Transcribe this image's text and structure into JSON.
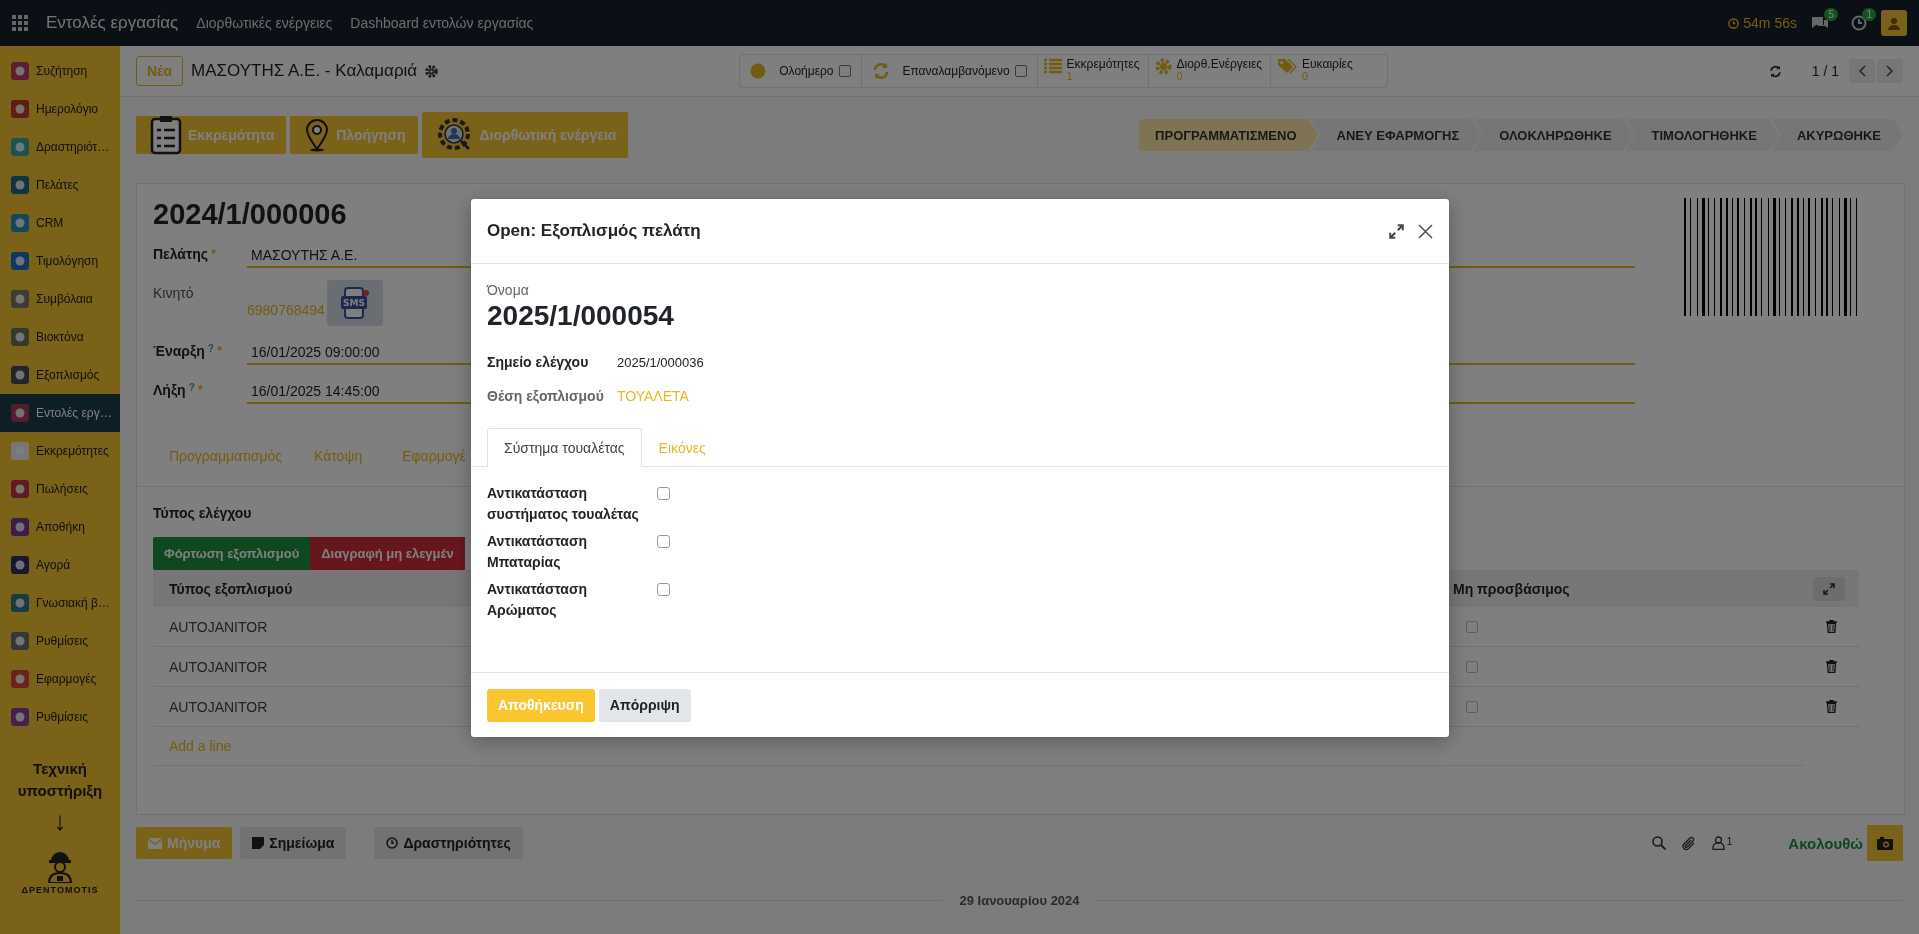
{
  "topbar": {
    "app_title": "Εντολές εργασίας",
    "links": [
      "Διορθωτικές ενέργειες",
      "Dashboard εντολών εργασίας"
    ],
    "timer": "54m 56s",
    "messages_count": "5",
    "activities_count": "1"
  },
  "sidebar": {
    "items": [
      {
        "label": "Συζήτηση",
        "selected": false
      },
      {
        "label": "Ημερολόγιο",
        "selected": false
      },
      {
        "label": "Δραστηριότ…",
        "selected": false
      },
      {
        "label": "Πελάτες",
        "selected": false
      },
      {
        "label": "CRM",
        "selected": false
      },
      {
        "label": "Τιμολόγηση",
        "selected": false
      },
      {
        "label": "Συμβόλαια",
        "selected": false
      },
      {
        "label": "Βιοκτόνα",
        "selected": false
      },
      {
        "label": "Εξοπλισμός",
        "selected": false
      },
      {
        "label": "Εντολές εργ…",
        "selected": true
      },
      {
        "label": "Εκκρεμότητες",
        "selected": false
      },
      {
        "label": "Πωλήσεις",
        "selected": false
      },
      {
        "label": "Αποθήκη",
        "selected": false
      },
      {
        "label": "Αγορά",
        "selected": false
      },
      {
        "label": "Γνωσιακή β…",
        "selected": false
      },
      {
        "label": "Ρυθμίσεις",
        "selected": false
      },
      {
        "label": "Εφαρμογές",
        "selected": false
      },
      {
        "label": "Ρυθμίσεις",
        "selected": false
      }
    ],
    "support_title": "Τεχνική υποστήριξη",
    "arrow": "↓",
    "logo_text": "ΔΡΕΝΤΟΜΟΤΙS"
  },
  "control_panel": {
    "new_button": "Νέα",
    "breadcrumb": "ΜΑΣΟΥΤΗΣ Α.Ε. - Καλαμαριά",
    "toggles": [
      {
        "label": "Ολοήμερο",
        "checked": false
      },
      {
        "label": "Επαναλαμβανόμενο",
        "checked": false
      }
    ],
    "stat_buttons": [
      {
        "label": "Εκκρεμότητες",
        "value": "1"
      },
      {
        "label": "Διορθ.Ενέργειες",
        "value": "0"
      },
      {
        "label": "Ευκαιρίες",
        "value": "0"
      }
    ],
    "pager": "1 / 1"
  },
  "action_buttons": [
    "Εκκρεμότητα",
    "Πλοήγηση",
    "Διορθωτική ενέργεια"
  ],
  "status_bar": [
    {
      "label": "ΠΡΟΓΡΑΜΜΑΤΙΣΜΕΝΟ",
      "selected": true
    },
    {
      "label": "ΑΝΕΥ ΕΦΑΡΜΟΓΗΣ",
      "selected": false
    },
    {
      "label": "ΟΛΟΚΛΗΡΩΘΗΚΕ",
      "selected": false
    },
    {
      "label": "ΤΙΜΟΛΟΓΗΘΗΚΕ",
      "selected": false
    },
    {
      "label": "ΑΚΥΡΩΘΗΚΕ",
      "selected": false
    }
  ],
  "form": {
    "title": "2024/1/000006",
    "fields": [
      {
        "label": "Πελάτης",
        "kind": "input",
        "value": "ΜΑΣΟΥΤΗΣ Α.Ε.",
        "required_mark": "*"
      },
      {
        "label": "Κινητό",
        "kind": "phone",
        "value": "6980768494",
        "sms_label": "SMS"
      },
      {
        "label": "Έναρξη",
        "kind": "input",
        "value": "16/01/2025 09:00:00",
        "help_mark": "?",
        "required_mark": "*"
      },
      {
        "label": "Λήξη",
        "kind": "input",
        "value": "16/01/2025 14:45:00",
        "help_mark": "?",
        "required_mark": "*"
      }
    ],
    "tabs": [
      "Προγραμματισμός",
      "Κάτοψη",
      "Εφαρμογέ"
    ],
    "section_label": "Τύπος ελέγχου",
    "buttons": [
      {
        "label": "Φόρτωση εξοπλισμού",
        "kind": "success"
      },
      {
        "label": "Διαγραφή μη ελεγμέν",
        "kind": "danger"
      }
    ],
    "columns": [
      "Τύπος εξοπλισμού",
      "Μη προσβάσιμος"
    ],
    "rows": [
      {
        "type": "AUTOJANITOR",
        "inaccessible": false
      },
      {
        "type": "AUTOJANITOR",
        "inaccessible": false
      },
      {
        "type": "AUTOJANITOR",
        "inaccessible": false
      }
    ],
    "add_line": "Add a line"
  },
  "chatter": {
    "buttons": [
      {
        "label": "Μήνυμα",
        "kind": "primary"
      },
      {
        "label": "Σημείωμα",
        "kind": "secondary"
      },
      {
        "label": "Δραστηριότητες",
        "kind": "secondary"
      }
    ],
    "followers_count": "1",
    "follow_label": "Ακολουθώ",
    "date": "29 Ιανουαρίου 2024"
  },
  "modal": {
    "title": "Open: Εξοπλισμός πελάτη",
    "name_label": "Όνομα",
    "name": "2025/1/000054",
    "fields": [
      {
        "label": "Σημείο ελέγχου",
        "value": "2025/1/000036",
        "kind": "text"
      },
      {
        "label": "Θέση εξοπλισμού",
        "value": "ΤΟΥΑΛΕΤΑ",
        "kind": "link"
      }
    ],
    "tabs": [
      {
        "label": "Σύστημα τουαλέτας",
        "selected": true
      },
      {
        "label": "Εικόνες",
        "selected": false
      }
    ],
    "checks": [
      {
        "label": "Αντικατάσταση συστήματος τουαλέτας",
        "checked": false
      },
      {
        "label": "Αντικατάσταση Μπαταρίας",
        "checked": false
      },
      {
        "label": "Αντικατάσταση Αρώματος",
        "checked": false
      }
    ],
    "buttons": [
      {
        "label": "Αποθήκευση",
        "kind": "primary"
      },
      {
        "label": "Απόρριψη",
        "kind": "secondary"
      }
    ]
  }
}
